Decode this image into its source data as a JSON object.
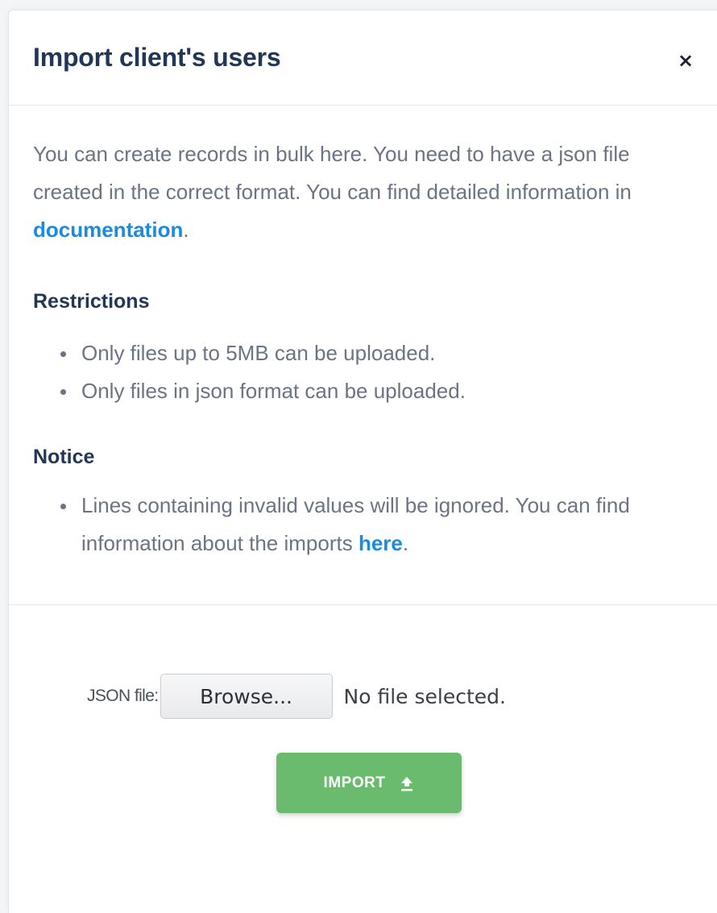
{
  "modal": {
    "title": "Import client's users",
    "close_label": "×"
  },
  "body": {
    "intro_text": "You can create records in bulk here. You need to have a json file created in the correct format. You can find detailed information in ",
    "intro_link": "documentation",
    "intro_end": ".",
    "restrictions": {
      "title": "Restrictions",
      "items": [
        "Only files up to 5MB can be uploaded.",
        "Only files in json format can be uploaded."
      ]
    },
    "notice": {
      "title": "Notice",
      "item_text": "Lines containing invalid values will be ignored. You can find information about the imports ",
      "item_link": "here",
      "item_end": "."
    }
  },
  "file_input": {
    "label": "JSON file:",
    "browse_label": "Browse...",
    "status": "No file selected."
  },
  "import_button": {
    "label": "IMPORT",
    "icon": "upload-icon",
    "color": "#6abb6d"
  },
  "colors": {
    "title": "#223657",
    "body_text": "#6b7484",
    "link": "#1b8be0"
  }
}
